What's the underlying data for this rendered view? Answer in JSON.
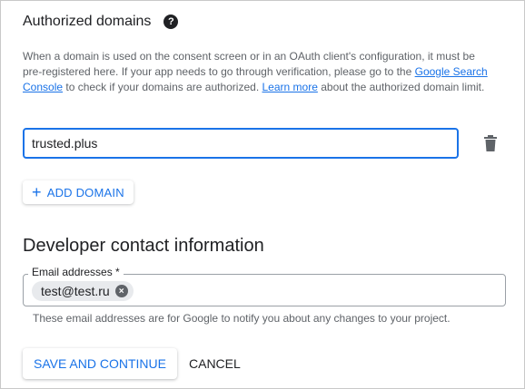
{
  "authorized_domains": {
    "title": "Authorized domains",
    "help_icon_glyph": "?",
    "description": {
      "part1": "When a domain is used on the consent screen or in an OAuth client's configuration, it must be pre-registered here. If your app needs to go through verification, please go to the",
      "link1": "Google Search Console",
      "part2": "to check if your domains are authorized.",
      "link2": "Learn more",
      "part3": "about the authorized domain limit."
    },
    "domain_value": "trusted.plus",
    "add_domain_label": "ADD DOMAIN",
    "add_icon": "+"
  },
  "developer_contact": {
    "heading": "Developer contact information",
    "email_label": "Email addresses *",
    "email_chip": "test@test.ru",
    "chip_remove_glyph": "×",
    "helper_text": "These email addresses are for Google to notify you about any changes to your project."
  },
  "actions": {
    "save_label": "SAVE AND CONTINUE",
    "cancel_label": "CANCEL"
  },
  "colors": {
    "accent": "#1a73e8",
    "text": "#202124",
    "muted": "#5f6368"
  }
}
